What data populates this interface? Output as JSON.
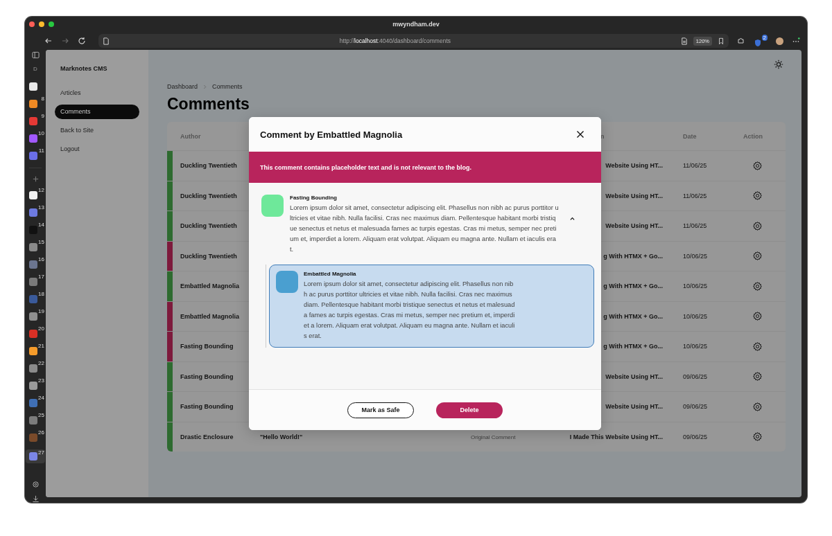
{
  "window": {
    "title": "mwyndham.dev"
  },
  "toolbar": {
    "url": "http://**localhost**:4040/dashboard/comments",
    "zoom": "120%",
    "extension_badge": "2"
  },
  "dock": {
    "label": "D",
    "top_items": [
      {
        "color": "#e8e8e8"
      },
      {
        "color": "#f08a24",
        "badge": "8"
      },
      {
        "color": "#e53935",
        "badge": "9"
      },
      {
        "color": "#a259ff",
        "badge": "10"
      },
      {
        "color": "#6a6ee8",
        "badge": "11"
      }
    ],
    "items": [
      {
        "color": "#f2f2f2",
        "badge": "12",
        "selected": false
      },
      {
        "color": "#6d7ae0",
        "badge": "13",
        "selected": false
      },
      {
        "color": "#111111",
        "badge": "14",
        "selected": false
      },
      {
        "color": "#8a8a8a",
        "badge": "15",
        "selected": false
      },
      {
        "color": "#6b7590",
        "badge": "16",
        "selected": false
      },
      {
        "color": "#7a7a7a",
        "badge": "17",
        "selected": false
      },
      {
        "color": "#3a5a9a",
        "badge": "18",
        "selected": false
      },
      {
        "color": "#909090",
        "badge": "19",
        "selected": false
      },
      {
        "color": "#d93025",
        "badge": "20",
        "selected": false
      },
      {
        "color": "#f59b2a",
        "badge": "21",
        "selected": false
      },
      {
        "color": "#8a8a8a",
        "badge": "22",
        "selected": false
      },
      {
        "color": "#9a9a9a",
        "badge": "23",
        "selected": false
      },
      {
        "color": "#3f6fb5",
        "badge": "24",
        "selected": false
      },
      {
        "color": "#7c7c7c",
        "badge": "25",
        "selected": false
      },
      {
        "color": "#7a4a2a",
        "badge": "26",
        "selected": false
      },
      {
        "color": "#7b86e6",
        "badge": "27",
        "selected": true
      }
    ]
  },
  "sidebar": {
    "title": "Marknotes CMS",
    "items": [
      {
        "label": "Articles",
        "selected": false
      },
      {
        "label": "Comments",
        "selected": true
      },
      {
        "label": "Back to Site",
        "selected": false
      },
      {
        "label": "Logout",
        "selected": false
      }
    ]
  },
  "breadcrumb": [
    "Dashboard",
    "Comments"
  ],
  "page_title": "Comments",
  "table": {
    "columns": [
      "Author",
      "n",
      "Date",
      "Action"
    ],
    "rows": [
      {
        "author": "Duckling Twentieth",
        "post": "Website Using HT...",
        "date": "11/06/25",
        "color": "#2e6b30"
      },
      {
        "author": "Duckling Twentieth",
        "post": "Website Using HT...",
        "date": "11/06/25",
        "color": "#2e6b30"
      },
      {
        "author": "Duckling Twentieth",
        "post": "Website Using HT...",
        "date": "11/06/25",
        "color": "#2e6b30"
      },
      {
        "author": "Duckling Twentieth",
        "post": "g With HTMX + Go...",
        "date": "10/06/25",
        "color": "#7d1a3c"
      },
      {
        "author": "Embattled Magnolia",
        "post": "g With HTMX + Go...",
        "date": "10/06/25",
        "color": "#2e6b30"
      },
      {
        "author": "Embattled Magnolia",
        "post": "g With HTMX + Go...",
        "date": "10/06/25",
        "color": "#7d1a3c"
      },
      {
        "author": "Fasting Bounding",
        "post": "g With HTMX + Go...",
        "date": "10/06/25",
        "color": "#7d1a3c"
      },
      {
        "author": "Fasting Bounding",
        "post": "Website Using HT...",
        "date": "09/06/25",
        "color": "#2e6b30"
      },
      {
        "author": "Fasting Bounding",
        "post": "Website Using HT...",
        "date": "09/06/25",
        "color": "#2e6b30"
      },
      {
        "author": "Drastic Enclosure",
        "comment": "\"Hello World!\"",
        "type": "Original Comment",
        "post": "I Made This Website Using HT...",
        "date": "09/06/25",
        "color": "#2e6b30"
      }
    ]
  },
  "modal": {
    "title": "Comment by Embattled Magnolia",
    "alert": "This comment contains placeholder text and is not relevant to the blog.",
    "comment": {
      "author": "Fasting Bounding",
      "color": "#6ee89a",
      "expanded": true,
      "text": "Lorem ipsum dolor sit amet, consectetur adipiscing elit. Phasellus non nibh ac purus porttitor ultricies et vitae nibh. Nulla facilisi. Cras nec maximus diam. Pellentesque habitant morbi tristique senectus et netus et malesuada fames ac turpis egestas. Cras mi metus, semper nec pretium et, imperdiet a lorem. Aliquam erat volutpat. Aliquam eu magna ante. Nullam et iaculis erat."
    },
    "reply": {
      "author": "Embattled Magnolia",
      "color": "#4a9fd0",
      "highlighted": true,
      "text": "Lorem ipsum dolor sit amet, consectetur adipiscing elit. Phasellus non nibh ac purus porttitor ultricies et vitae nibh. Nulla facilisi. Cras nec maximus diam. Pellentesque habitant morbi tristique senectus et netus et malesuada fames ac turpis egestas. Cras mi metus, semper nec pretium et, imperdiet a lorem. Aliquam erat volutpat. Aliquam eu magna ante. Nullam et iaculis erat."
    },
    "buttons": [
      {
        "label": "Mark as Safe",
        "kind": "outline"
      },
      {
        "label": "Delete",
        "kind": "danger"
      }
    ]
  }
}
